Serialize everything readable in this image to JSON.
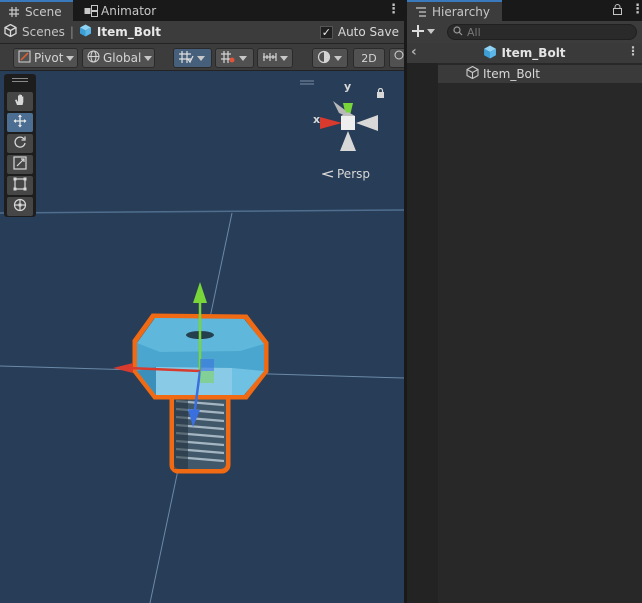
{
  "scene_panel": {
    "tabs": [
      {
        "label": "Scene",
        "icon": "grid-icon"
      },
      {
        "label": "Animator",
        "icon": "animator-icon"
      }
    ],
    "breadcrumb": {
      "root": "Scenes",
      "current": "Item_Bolt"
    },
    "auto_save": {
      "label": "Auto Save",
      "checked": true
    },
    "toolbar": {
      "pivot_label": "Pivot",
      "global_label": "Global",
      "mode_2d_label": "2D"
    },
    "tools": [
      "hand-tool",
      "move-tool",
      "rotate-tool",
      "scale-tool",
      "rect-tool",
      "transform-tool"
    ],
    "selected_tool": "move-tool",
    "gizmo": {
      "x_label": "x",
      "y_label": "y",
      "projection_label": "Persp"
    }
  },
  "hierarchy_panel": {
    "tab_label": "Hierarchy",
    "search_placeholder": "All",
    "scene_name": "Item_Bolt",
    "items": [
      {
        "label": "Item_Bolt",
        "selected": true
      }
    ]
  },
  "colors": {
    "accent": "#3a79bb",
    "viewport_bg": "#283d57",
    "selection_outline": "#f06a14",
    "axis_x": "#d83a2e",
    "axis_y": "#79d63a",
    "axis_z": "#3a6fe0"
  }
}
